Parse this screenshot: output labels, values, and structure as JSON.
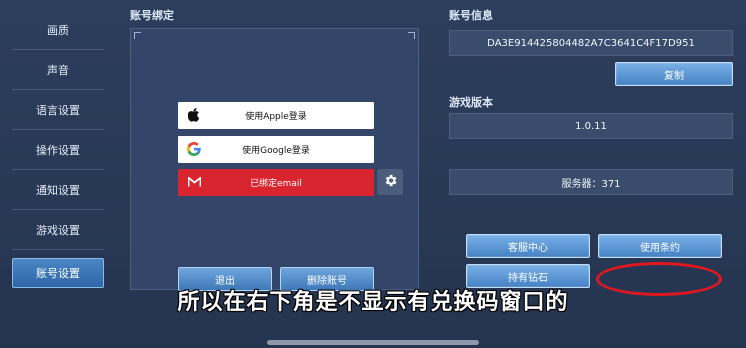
{
  "sidebar": {
    "items": [
      {
        "label": "画质"
      },
      {
        "label": "声音"
      },
      {
        "label": "语言设置"
      },
      {
        "label": "操作设置"
      },
      {
        "label": "通知设置"
      },
      {
        "label": "游戏设置"
      },
      {
        "label": "账号设置",
        "active": true
      }
    ]
  },
  "account_binding": {
    "heading": "账号绑定",
    "apple_label": "使用Apple登录",
    "google_label": "使用Google登录",
    "email_label": "已绑定email",
    "logout_label": "退出",
    "delete_label": "删除账号"
  },
  "account_info": {
    "heading": "账号信息",
    "account_id": "DA3E914425804482A7C3641C4F17D951",
    "copy_label": "复制"
  },
  "game_version": {
    "heading": "游戏版本",
    "version": "1.0.11",
    "server": "服务器：371"
  },
  "actions": {
    "support_label": "客服中心",
    "terms_label": "使用条约",
    "diamonds_label": "持有钻石"
  },
  "subtitle": "所以在右下角是不显示有兑换码窗口的",
  "colors": {
    "accent_blue": "#4683c4",
    "email_red": "#d9252f",
    "annotation_red": "#e0171f"
  }
}
